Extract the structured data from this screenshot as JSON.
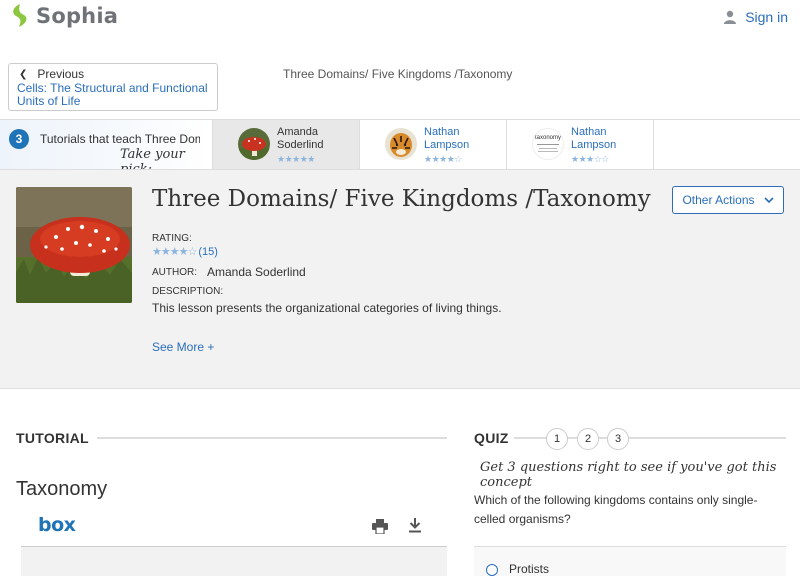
{
  "header": {
    "brand": "Sophia",
    "signin_label": "Sign in",
    "logo_color": "#8dc63f",
    "link_color": "#2a6ebb"
  },
  "breadcrumb": {
    "previous_label": "Previous",
    "previous_link": "Cells: The Structural and Functional Units of Life",
    "page_heading": "Three Domains/ Five Kingdoms /Taxonomy"
  },
  "tutorial_strip": {
    "count": "3",
    "title": "Tutorials that teach Three Domains/ Five Kingdoms /Taxonomy",
    "pick_text": "Take your pick:",
    "cards": [
      {
        "author": "Amanda Soderlind",
        "rating_stars": "★★★★★",
        "thumb": "mushroom-thumbnail",
        "active": true
      },
      {
        "author": "Nathan Lampson",
        "rating_stars": "★★★★☆",
        "thumb": "tiger-thumbnail",
        "active": false
      },
      {
        "author": "Nathan Lampson",
        "rating_stars": "★★★☆☆",
        "thumb": "taxonomy-diagram-thumbnail",
        "thumb_label": "taxonomy",
        "active": false
      }
    ]
  },
  "lesson": {
    "title": "Three Domains/ Five Kingdoms /Taxonomy",
    "other_actions_label": "Other Actions",
    "rating_label": "RATING:",
    "rating_stars": "★★★★☆",
    "rating_count": "(15)",
    "author_label": "AUTHOR:",
    "author_name": "Amanda Soderlind",
    "description_label": "DESCRIPTION:",
    "description": "This lesson presents the organizational categories of living things.",
    "see_more_label": "See More +"
  },
  "tutorial": {
    "section_label": "TUTORIAL",
    "title": "Taxonomy",
    "viewer_brand": "box",
    "print_icon": "print-icon",
    "download_icon": "download-icon"
  },
  "quiz": {
    "section_label": "QUIZ",
    "steps": [
      "1",
      "2",
      "3"
    ],
    "hint": "Get 3 questions right to see if you've got this concept",
    "question": "Which of the following kingdoms contains only single-celled organisms?",
    "answers": [
      "Protists"
    ]
  }
}
